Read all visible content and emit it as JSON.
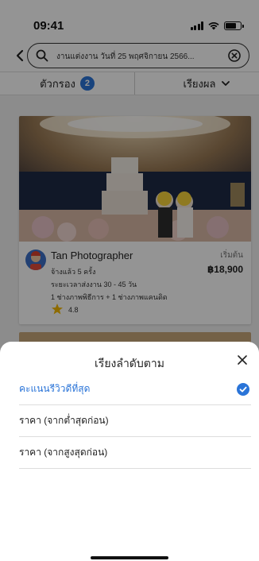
{
  "status_bar": {
    "time": "09:41"
  },
  "search": {
    "query": "งานแต่งงาน  วันที่ 25 พฤศจิกายน 2566..."
  },
  "filter_bar": {
    "filter_label": "ตัวกรอง",
    "filter_count": "2",
    "sort_label": "เรียงผล"
  },
  "listing": {
    "name": "Tan Photographer",
    "hired": "จ้างแล้ว 5 ครั้ง",
    "delivery": "ระยะเวลาส่งงาน 30 - 45 วัน",
    "team": "1 ช่างภาพพิธีการ + 1 ช่างภาพแคนดิด",
    "rating": "4.8",
    "price_label": "เริ่มต้น",
    "price": "฿18,900"
  },
  "sort_sheet": {
    "title": "เรียงลำดับตาม",
    "options": [
      {
        "label": "คะแนนรีวิวดีที่สุด",
        "selected": true
      },
      {
        "label": "ราคา (จากต่ำสุดก่อน)",
        "selected": false
      },
      {
        "label": "ราคา (จากสูงสุดก่อน)",
        "selected": false
      }
    ]
  },
  "colors": {
    "accent": "#2a74d8",
    "star": "#f5b800"
  }
}
